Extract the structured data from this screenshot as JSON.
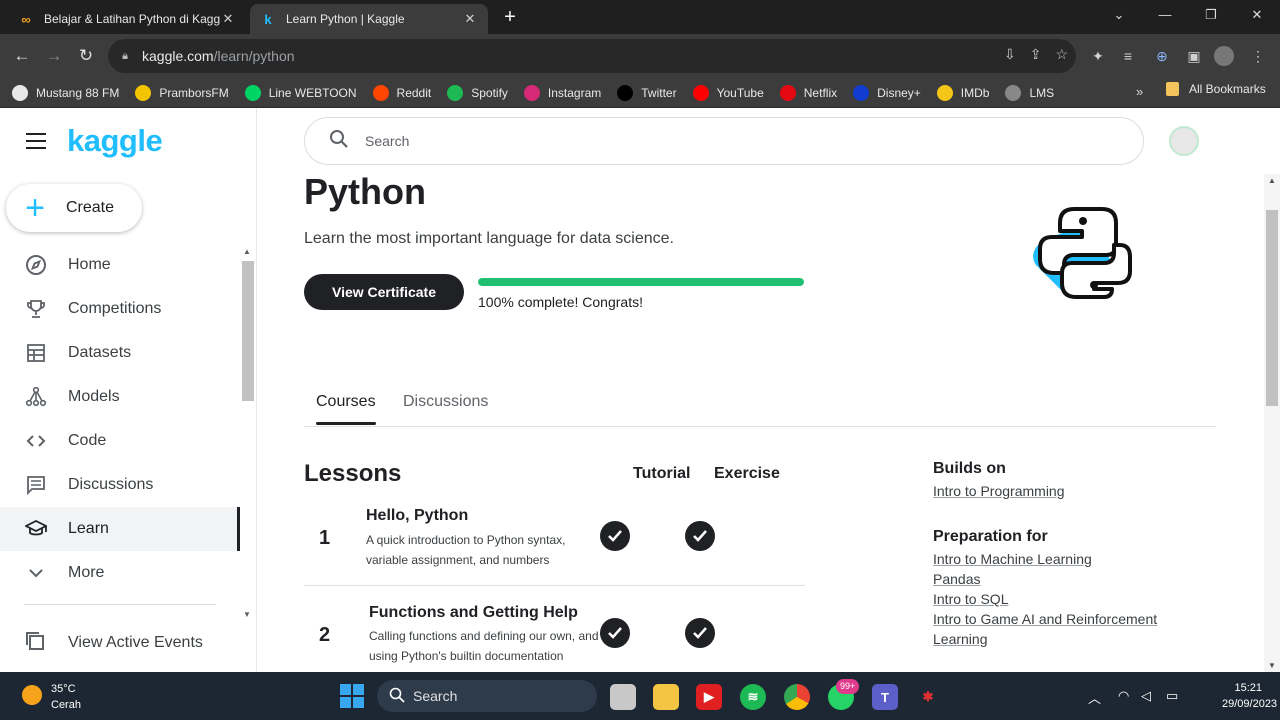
{
  "browser": {
    "tabs": [
      {
        "title": "Belajar & Latihan Python di Kagg",
        "favicon": "infinity-icon"
      },
      {
        "title": "Learn Python | Kaggle",
        "favicon": "kaggle-k-icon"
      }
    ],
    "url_domain": "kaggle.com",
    "url_path": "/learn/python",
    "bookmarks": [
      {
        "label": "Mustang 88 FM",
        "color": "#e8e8e8",
        "icon": "globe-icon"
      },
      {
        "label": "PramborsFM",
        "color": "#f5c400",
        "icon": "prambors-icon"
      },
      {
        "label": "Line WEBTOON",
        "color": "#00d564",
        "icon": "webtoon-icon"
      },
      {
        "label": "Reddit",
        "color": "#ff4500",
        "icon": "reddit-icon"
      },
      {
        "label": "Spotify",
        "color": "#1db954",
        "icon": "spotify-icon"
      },
      {
        "label": "Instagram",
        "color": "#d62976",
        "icon": "instagram-icon"
      },
      {
        "label": "Twitter",
        "color": "#000000",
        "icon": "x-icon"
      },
      {
        "label": "YouTube",
        "color": "#ff0000",
        "icon": "youtube-icon"
      },
      {
        "label": "Netflix",
        "color": "#e50914",
        "icon": "netflix-icon"
      },
      {
        "label": "Disney+",
        "color": "#113ccf",
        "icon": "disney-icon"
      },
      {
        "label": "IMDb",
        "color": "#f5c518",
        "icon": "imdb-icon"
      },
      {
        "label": "LMS",
        "color": "#888888",
        "icon": "lms-icon"
      }
    ],
    "bookmarks_more": "»",
    "all_bookmarks": "All Bookmarks"
  },
  "sidebar": {
    "logo": "kaggle",
    "create_label": "Create",
    "items": [
      {
        "label": "Home",
        "icon": "compass-icon"
      },
      {
        "label": "Competitions",
        "icon": "trophy-icon"
      },
      {
        "label": "Datasets",
        "icon": "table-icon"
      },
      {
        "label": "Models",
        "icon": "models-icon"
      },
      {
        "label": "Code",
        "icon": "code-icon"
      },
      {
        "label": "Discussions",
        "icon": "comment-icon"
      },
      {
        "label": "Learn",
        "icon": "school-icon"
      },
      {
        "label": "More",
        "icon": "chevron-down-icon"
      }
    ],
    "active_item": "Learn",
    "view_active_events": "View Active Events"
  },
  "search": {
    "placeholder": "Search"
  },
  "course": {
    "title": "Python",
    "subtitle": "Learn the most important language for data science.",
    "certificate_button": "View Certificate",
    "progress_fraction": 1.0,
    "progress_label": "100% complete! Congrats!"
  },
  "tabs": [
    {
      "label": "Courses",
      "active": true
    },
    {
      "label": "Discussions",
      "active": false
    }
  ],
  "lessons": {
    "heading": "Lessons",
    "col_tutorial": "Tutorial",
    "col_exercise": "Exercise",
    "items": [
      {
        "num": "1",
        "title": "Hello, Python",
        "desc_line1": "A quick introduction to Python syntax,",
        "desc_line2": "variable assignment, and numbers",
        "tutorial_done": true,
        "exercise_done": true
      },
      {
        "num": "2",
        "title": "Functions and Getting Help",
        "desc_line1": "Calling functions and defining our own, and",
        "desc_line2": "using Python's builtin documentation",
        "tutorial_done": true,
        "exercise_done": true
      }
    ]
  },
  "related": {
    "builds_on_heading": "Builds on",
    "builds_on": [
      "Intro to Programming"
    ],
    "preparation_heading": "Preparation for",
    "preparation": [
      "Intro to Machine Learning",
      "Pandas",
      "Intro to SQL",
      "Intro to Game AI and Reinforcement",
      "Learning"
    ]
  },
  "taskbar": {
    "temperature": "35°C",
    "weather": "Cerah",
    "search_label": "Search",
    "whatsapp_badge": "99+",
    "time": "15:21",
    "date": "29/09/2023"
  },
  "colors": {
    "kaggle_blue": "#20beff",
    "progress_green": "#20c070",
    "dark": "#202124"
  }
}
